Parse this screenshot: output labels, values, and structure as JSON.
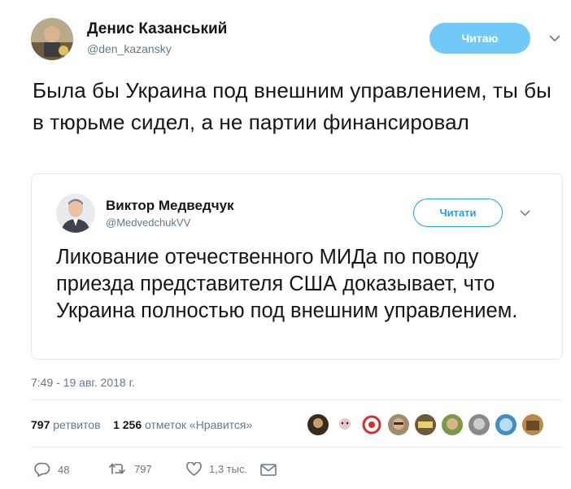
{
  "tweet": {
    "author_name": "Денис Казанський",
    "author_handle": "@den_kazansky",
    "follow_label": "Читаю",
    "text": "Была бы Украина под внешним управлением, ты бы в тюрьме сидел, а не партии финансировал",
    "timestamp": "7:49 - 19 авг. 2018 г."
  },
  "quoted": {
    "author_name": "Виктор Медведчук",
    "author_handle": "@MedvedchukVV",
    "follow_label": "Читати",
    "text": "Ликование отечественного МИДа по поводу приезда представителя США доказывает, что Украина полностью под внешним управлением."
  },
  "stats": {
    "retweets_count": "797",
    "retweets_label": "ретвитов",
    "likes_count": "1 256",
    "likes_label": "отметок «Нравится»"
  },
  "actions": {
    "replies": "48",
    "retweets": "797",
    "likes": "1,3 тыс."
  },
  "colors": {
    "accent": "#1da1f2",
    "button_bg": "#71c9f8",
    "muted": "#657786"
  }
}
